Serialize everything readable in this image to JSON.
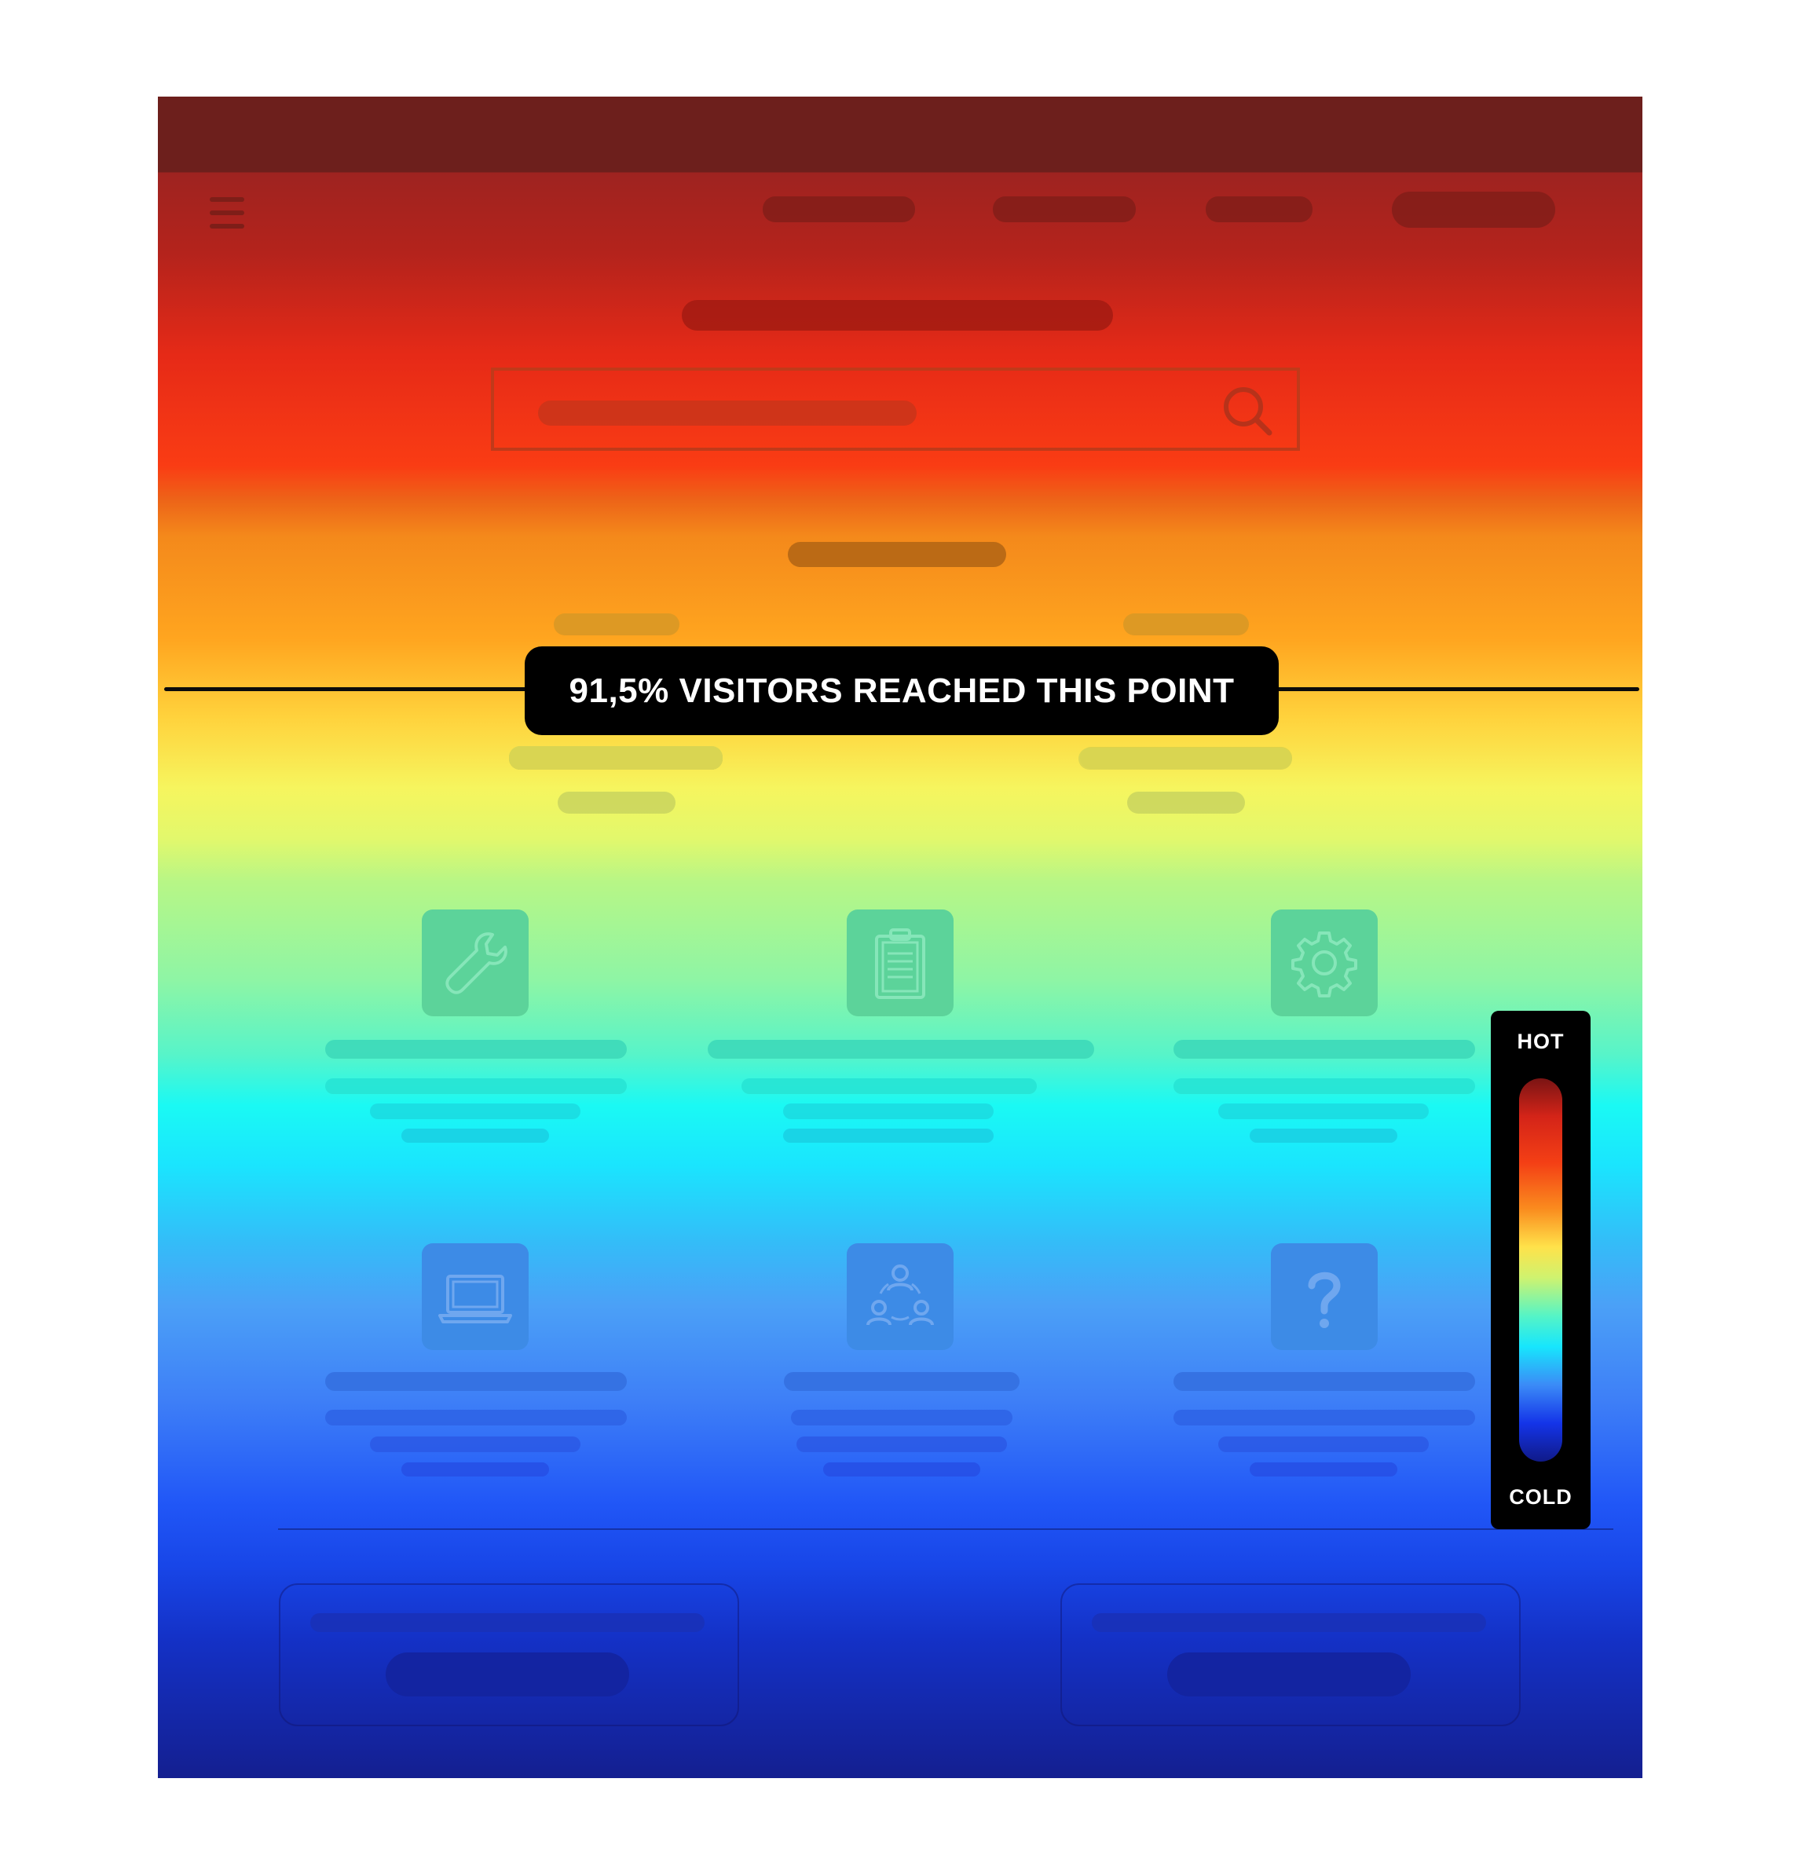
{
  "scroll_marker": {
    "percent_reached": 91.5,
    "label": "91,5% VISITORS REACHED THIS POINT"
  },
  "legend": {
    "hot_label": "HOT",
    "cold_label": "COLD"
  },
  "colors": {
    "hot": "#e62a17",
    "warm": "#ffa51f",
    "neutral": "#f6f55e",
    "cool": "#1af9f4",
    "cold": "#141f90",
    "badge_background": "#000000",
    "badge_text": "#ffffff"
  },
  "feature_icons": [
    "wrench-icon",
    "clipboard-icon",
    "gear-icon",
    "laptop-icon",
    "team-icon",
    "question-icon"
  ],
  "header_icons": [
    "hamburger-menu-icon",
    "search-icon"
  ]
}
